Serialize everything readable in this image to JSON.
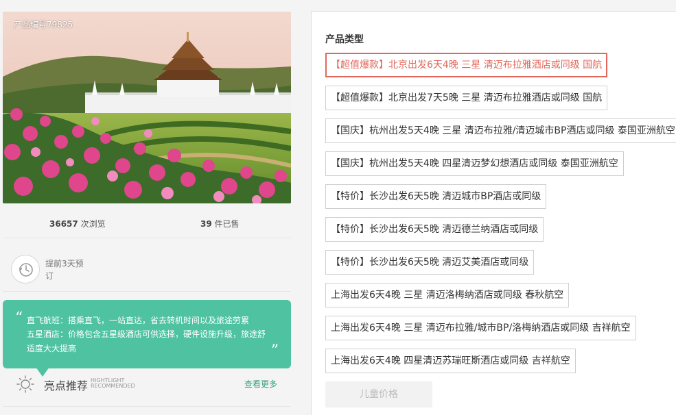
{
  "product": {
    "id_label": "产品编号79825",
    "views_count": "36657",
    "views_label": "次浏览",
    "sold_count": "39",
    "sold_label": "件已售",
    "booking_note": "提前3天预订"
  },
  "quote": {
    "line1": "直飞航班：搭乘直飞，一站直达，省去转机时间以及旅途劳累",
    "line2": "五星酒店：价格包含五星级酒店可供选择，硬件设施升级，旅途舒适度大大提高"
  },
  "highlight": {
    "title": "亮点推荐",
    "sub_en_1": "HIGHTLIGHT",
    "sub_en_2": "RECOMMENDED",
    "more_link": "查看更多"
  },
  "product_types": {
    "title": "产品类型",
    "selected_index": 0,
    "options": [
      "【超值爆款】北京出发6天4晚 三星 清迈布拉雅酒店或同级 国航",
      "【超值爆款】北京出发7天5晚 三星 清迈布拉雅酒店或同级 国航",
      "【国庆】杭州出发5天4晚 三星 清迈布拉雅/清迈城市BP酒店或同级 泰国亚洲航空",
      "【国庆】杭州出发5天4晚 四星清迈梦幻想酒店或同级 泰国亚洲航空",
      "【特价】长沙出发6天5晚 清迈城市BP酒店或同级",
      "【特价】长沙出发6天5晚 清迈德兰纳酒店或同级",
      "【特价】长沙出发6天5晚 清迈艾美酒店或同级",
      "上海出发6天4晚 三星 清迈洛梅纳酒店或同级 春秋航空",
      "上海出发6天4晚 三星 清迈布拉雅/城市BP/洛梅纳酒店或同级 吉祥航空",
      "上海出发6天4晚 四星清迈苏瑞旺斯酒店或同级 吉祥航空"
    ],
    "child_price_label": "儿童价格"
  },
  "colors": {
    "accent_green": "#4fc3a1",
    "link_green": "#2fa27c",
    "selected_red": "#e2675a"
  },
  "icons": [
    "clock-icon",
    "sun-icon",
    "quote-open-icon",
    "quote-close-icon"
  ]
}
